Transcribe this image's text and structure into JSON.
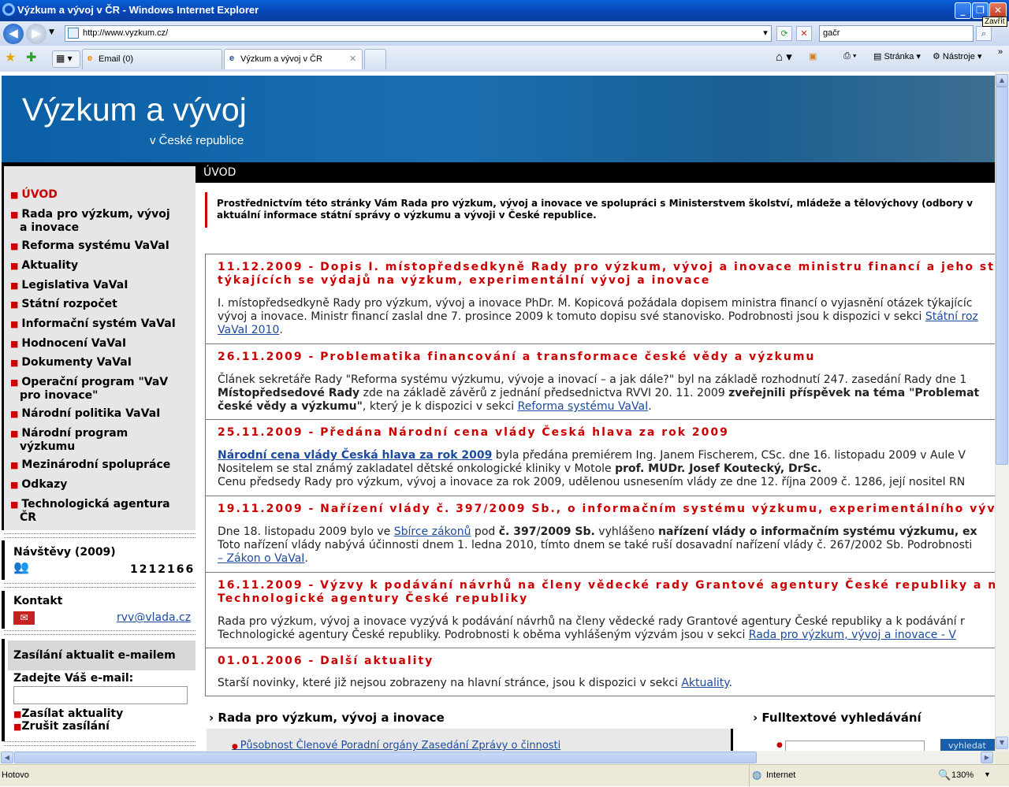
{
  "window": {
    "title": "Výzkum a vývoj v ČR - Windows Internet Explorer",
    "tooltip": "Zavřít",
    "min_label": "_",
    "max_label": "❐",
    "close_label": "✕"
  },
  "address": {
    "url": "http://www.vyzkum.cz/",
    "search_value": "gačr"
  },
  "tabs": [
    {
      "label": "Email (0)"
    },
    {
      "label": "Výzkum a vývoj v ČR"
    }
  ],
  "toolbar": {
    "page_label": "Stránka",
    "tools_label": "Nástroje"
  },
  "banner": {
    "title": "Výzkum a vývoj",
    "subtitle": "v České republice"
  },
  "section_title": "ÚVOD",
  "nav": [
    {
      "label": "ÚVOD"
    },
    {
      "label": "Rada pro výzkum, vývoj",
      "label2": "a inovace"
    },
    {
      "label": "Reforma systému VaVaI"
    },
    {
      "label": "Aktuality"
    },
    {
      "label": "Legislativa VaVaI"
    },
    {
      "label": "Státní rozpočet"
    },
    {
      "label": "Informační systém VaVaI"
    },
    {
      "label": "Hodnocení VaVaI"
    },
    {
      "label": "Dokumenty VaVaI"
    },
    {
      "label": "Operační program \"VaV",
      "label2": "pro inovace\""
    },
    {
      "label": "Národní politika VaVaI"
    },
    {
      "label": "Národní program",
      "label2": "výzkumu"
    },
    {
      "label": "Mezinárodní spolupráce"
    },
    {
      "label": "Odkazy"
    },
    {
      "label": "Technologická agentura",
      "label2": "ČR"
    }
  ],
  "visits": {
    "label": "Návštěvy (2009)",
    "count": "1212166"
  },
  "contact": {
    "label": "Kontakt",
    "email": "rvv@vlada.cz"
  },
  "newsletter": {
    "title": "Zasílání aktualit e-mailem",
    "prompt": "Zadejte Váš e-mail:",
    "subscribe": "Zasílat aktuality",
    "unsubscribe": "Zrušit zasílání"
  },
  "intro": {
    "line1": "Prostřednictvím této stránky Vám Rada pro výzkum, vývoj a inovace ve spolupráci s Ministerstvem školství, mládeže a tělovýchovy (odbory v",
    "line2": "aktuální informace státní správy o výzkumu a vývoji v České republice."
  },
  "news": [
    {
      "h1": "11.12.2009 - Dopis I. místopředsedkyně Rady pro výzkum, vývoj a inovace ministru financí a jeho sta",
      "h2": "týkajících se výdajů na výzkum, experimentální vývoj a inovace",
      "l1": "I. místopředsedkyně Rady pro výzkum, vývoj a inovace PhDr. M. Kopicová požádala dopisem ministra financí o vyjasnění otázek týkajícíc",
      "l2": "vývoj a inovace. Ministr financí zaslal dne 7. prosince 2009 k tomuto dopisu své stanovisko. Podrobnosti jsou k dispozici v sekci ",
      "l2link": "Státní roz",
      "l3link": "VaVaI 2010",
      "l3": "."
    },
    {
      "h1": "26.11.2009 - Problematika financování a transformace české vědy a výzkumu",
      "l1": "Článek sekretáře Rady \"Reforma systému výzkumu, vývoje a inovací – a jak dále?\" byl na základě rozhodnutí 247. zasedání Rady dne 1",
      "l2b": "Místopředsedové Rady",
      "l2": " zde na základě závěrů z jednání předsednictva RVVI 20. 11. 2009 ",
      "l2c": "zveřejnili příspěvek na téma \"Problemat",
      "l3b": "české vědy a výzkumu\"",
      "l3": ", který je k dispozici v sekci ",
      "l3link": "Reforma systému VaVaI",
      "l3e": "."
    },
    {
      "h1": "25.11.2009 - Předána Národní cena vlády Česká hlava za rok 2009",
      "l1link": "Národní cena vlády Česká hlava za rok 2009",
      "l1": " byla předána premiérem Ing. Janem Fischerem, CSc. dne 16. listopadu 2009 v Aule V",
      "l2": "Nositelem se stal známý zakladatel dětské onkologické kliniky v Motole ",
      "l2b": "prof. MUDr. Josef Koutecký, DrSc.",
      "l3": "Cenu předsedy Rady pro výzkum, vývoj a inovace za rok 2009, udělenou usnesením vlády ze dne 12. října 2009 č. 1286, její nositel RN"
    },
    {
      "h1": "19.11.2009 - Nařízení vlády č. 397/2009 Sb., o informačním systému výzkumu, experimentálního výv",
      "l1a": "Dne 18. listopadu 2009 bylo ve ",
      "l1link": "Sbírce zákonů",
      "l1b": " pod ",
      "l1c": "č. 397/2009 Sb.",
      "l1d": " vyhlášeno ",
      "l1e": "nařízení vlády o informačním systému výzkumu, ex",
      "l2": "Toto nařízení vlády nabývá účinnosti dnem 1. ledna 2010, tímto dnem se také ruší dosavadní nařízení vlády č. 267/2002 Sb. Podrobnosti",
      "l3link": "– Zákon o VaVaI",
      "l3": "."
    },
    {
      "h1": "16.11.2009 - Výzvy k podávání návrhů na členy vědecké rady Grantové agentury České republiky a n",
      "h2": "Technologické agentury České republiky",
      "l1": "Rada pro výzkum, vývoj a inovace vyzývá k podávání návrhů na členy vědecké rady Grantové agentury České republiky a k podávání r",
      "l2": "Technologické agentury České republiky. Podrobnosti k oběma vyhlášeným výzvám jsou v sekci ",
      "l2link": "Rada pro výzkum, vývoj a inovace - V"
    },
    {
      "h1": "01.01.2006 - Další aktuality",
      "l1": "Starší novinky, které již nejsou zobrazeny na hlavní stránce, jsou k dispozici v sekci ",
      "l1link": "Aktuality",
      "l1e": "."
    }
  ],
  "bottom": {
    "rada_title": "Rada pro výzkum, vývoj a inovace",
    "rada_links": "Působnost  Členové  Poradní orgány  Zasedání  Zprávy o činnosti",
    "search_title": "Fulltextové vyhledávání",
    "search_btn": "vyhledat"
  },
  "status": {
    "left": "Hotovo",
    "zone": "Internet",
    "zoom": "130%"
  }
}
